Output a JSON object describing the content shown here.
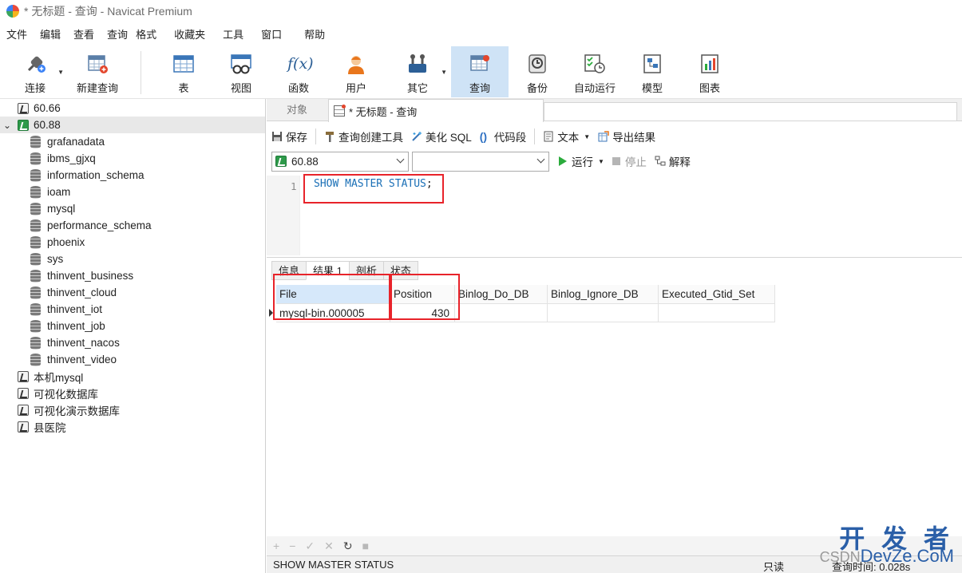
{
  "window": {
    "title": "* 无标题 - 查询 - Navicat Premium"
  },
  "menu": [
    "文件",
    "编辑",
    "查看",
    "查询",
    "格式",
    "收藏夹",
    "工具",
    "窗口",
    "帮助"
  ],
  "toolbar": {
    "items": [
      {
        "label": "连接",
        "icon": "plug-icon",
        "dropdown": true
      },
      {
        "label": "新建查询",
        "icon": "new-query-icon"
      },
      {
        "label": "表",
        "icon": "table-icon"
      },
      {
        "label": "视图",
        "icon": "view-icon"
      },
      {
        "label": "函数",
        "icon": "function-icon",
        "glyph": "f(x)"
      },
      {
        "label": "用户",
        "icon": "user-icon"
      },
      {
        "label": "其它",
        "icon": "tools-icon",
        "dropdown": true
      },
      {
        "label": "查询",
        "icon": "query-icon",
        "active": true
      },
      {
        "label": "备份",
        "icon": "backup-icon"
      },
      {
        "label": "自动运行",
        "icon": "schedule-icon"
      },
      {
        "label": "模型",
        "icon": "model-icon"
      },
      {
        "label": "图表",
        "icon": "chart-icon"
      }
    ]
  },
  "sidebar": {
    "connections": [
      {
        "name": "60.66",
        "active": false
      },
      {
        "name": "60.88",
        "active": true,
        "expanded": true
      }
    ],
    "databases": [
      "grafanadata",
      "ibms_gjxq",
      "information_schema",
      "ioam",
      "mysql",
      "performance_schema",
      "phoenix",
      "sys",
      "thinvent_business",
      "thinvent_cloud",
      "thinvent_iot",
      "thinvent_job",
      "thinvent_nacos",
      "thinvent_video"
    ],
    "other_connections": [
      "本机mysql",
      "可视化数据库",
      "可视化演示数据库",
      "县医院"
    ]
  },
  "tabs": {
    "objects": "对象",
    "query": "* 无标题 - 查询"
  },
  "query_toolbar": {
    "save": "保存",
    "builder": "查询创建工具",
    "beautify": "美化 SQL",
    "snippet": "代码段",
    "text": "文本",
    "export": "导出结果"
  },
  "run_bar": {
    "connection": "60.88",
    "database": "",
    "run": "运行",
    "stop": "停止",
    "explain": "解释"
  },
  "editor": {
    "line_number": "1",
    "sql": "SHOW MASTER STATUS",
    "terminator": ";"
  },
  "result_tabs": [
    "信息",
    "结果 1",
    "剖析",
    "状态"
  ],
  "result": {
    "columns": [
      "File",
      "Position",
      "Binlog_Do_DB",
      "Binlog_Ignore_DB",
      "Executed_Gtid_Set"
    ],
    "rows": [
      [
        "mysql-bin.000005",
        "430",
        "",
        "",
        ""
      ]
    ]
  },
  "grid_actions": [
    "+",
    "−",
    "✓",
    "✕",
    "↻",
    "■"
  ],
  "status": {
    "sql": "SHOW MASTER STATUS",
    "mode": "只读",
    "time": "查询时间: 0.028s"
  },
  "watermark": {
    "big": "开 发 者",
    "small": "DevZe.CoM",
    "prefix": "CSDN"
  },
  "colors": {
    "accent": "#cfe3f6",
    "highlight_box": "#e8232a",
    "sql_keyword": "#1a6fb6",
    "run": "#2bab3c"
  }
}
